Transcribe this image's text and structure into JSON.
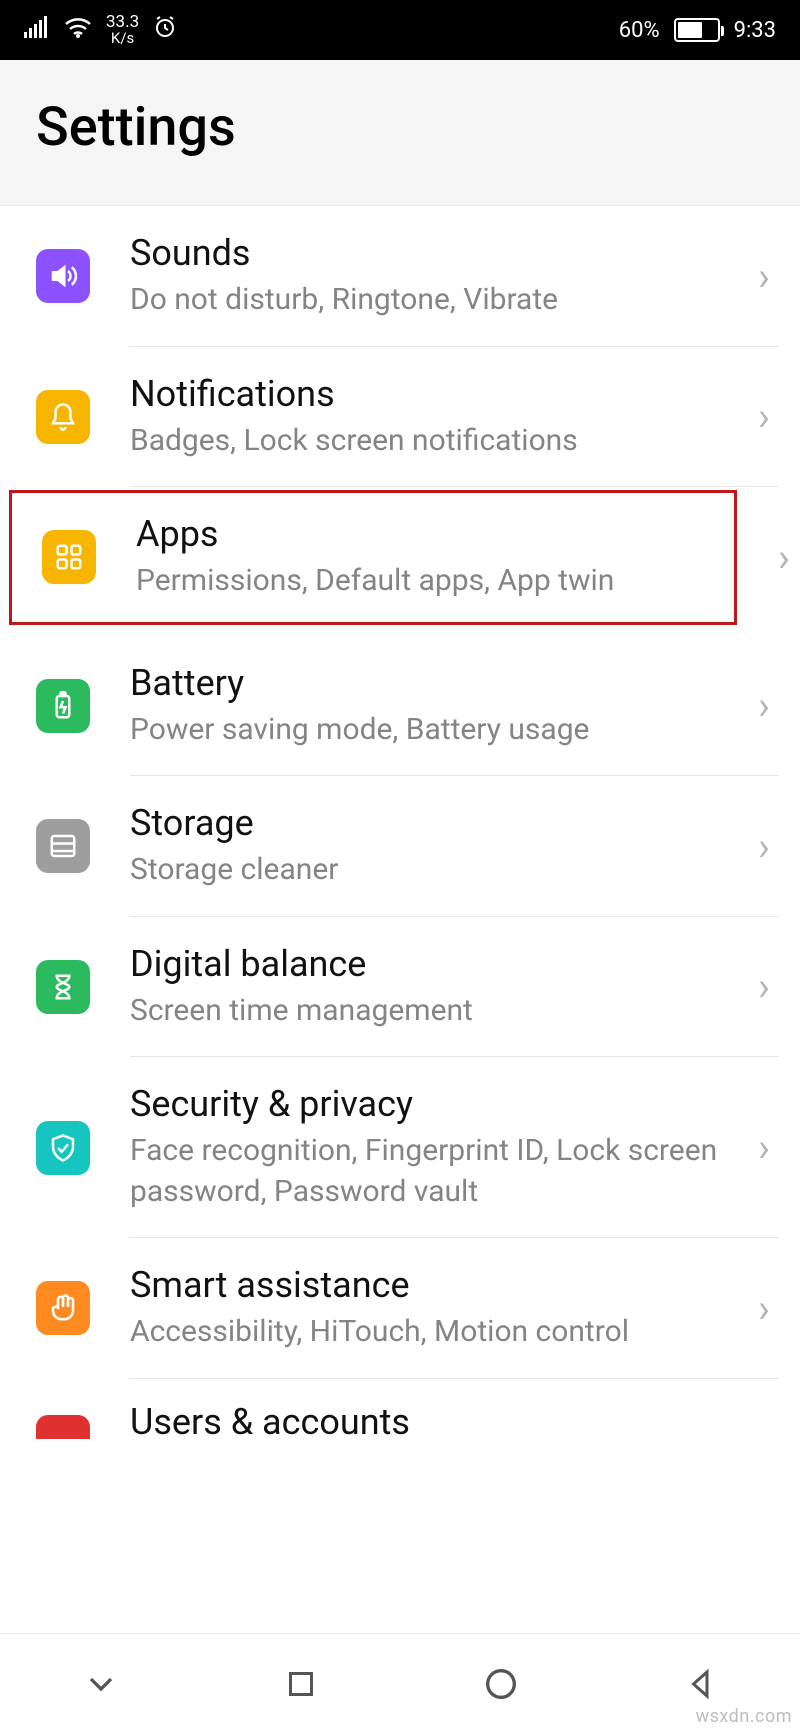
{
  "status": {
    "net_speed_value": "33.3",
    "net_speed_unit": "K/s",
    "battery_pct": "60%",
    "time": "9:33"
  },
  "header": {
    "title": "Settings"
  },
  "items": {
    "sounds": {
      "title": "Sounds",
      "subtitle": "Do not disturb, Ringtone, Vibrate"
    },
    "notifications": {
      "title": "Notifications",
      "subtitle": "Badges, Lock screen notifications"
    },
    "apps": {
      "title": "Apps",
      "subtitle": "Permissions, Default apps, App twin"
    },
    "battery": {
      "title": "Battery",
      "subtitle": "Power saving mode, Battery usage"
    },
    "storage": {
      "title": "Storage",
      "subtitle": "Storage cleaner"
    },
    "digital": {
      "title": "Digital balance",
      "subtitle": "Screen time management"
    },
    "security": {
      "title": "Security & privacy",
      "subtitle": "Face recognition, Fingerprint ID, Lock screen password, Password vault"
    },
    "smart": {
      "title": "Smart assistance",
      "subtitle": "Accessibility, HiTouch, Motion control"
    },
    "users": {
      "title": "Users & accounts",
      "subtitle": ""
    }
  },
  "watermark": "wsxdn.com"
}
